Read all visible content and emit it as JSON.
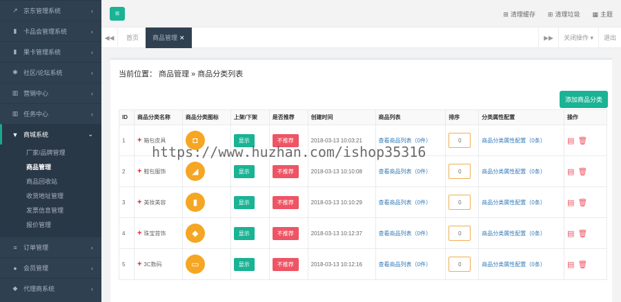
{
  "sidebar": {
    "items_top": [
      {
        "icon": "chart-icon",
        "glyph": "↗",
        "label": "京东管理系统"
      },
      {
        "icon": "bar-chart-icon",
        "glyph": "▮",
        "label": "卡品会管理系统"
      },
      {
        "icon": "bar-chart-icon",
        "glyph": "▮",
        "label": "果卡管理系统"
      },
      {
        "icon": "users-icon",
        "glyph": "✱",
        "label": "社区/论坛系统"
      },
      {
        "icon": "chart-icon",
        "glyph": "▥",
        "label": "营销中心"
      },
      {
        "icon": "chart-icon",
        "glyph": "▥",
        "label": "任务中心"
      }
    ],
    "active": {
      "icon": "cart-icon",
      "glyph": "▼",
      "label": "商城系统"
    },
    "sub_items": [
      "厂家/品牌管理",
      "商品管理",
      "商品回收站",
      "收货地址管理",
      "发票信息管理",
      "报价管理"
    ],
    "items_bottom": [
      {
        "icon": "list-icon",
        "glyph": "≡",
        "label": "订单管理"
      },
      {
        "icon": "user-icon",
        "glyph": "●",
        "label": "会员管理"
      },
      {
        "icon": "agent-icon",
        "glyph": "◆",
        "label": "代理商系统"
      }
    ]
  },
  "topbar": {
    "menu_glyph": "≡",
    "links": [
      "清理缓存",
      "清理垃圾",
      "主题"
    ]
  },
  "tabs": {
    "home": "首页",
    "active": "商品管理",
    "close_glyph": "✕",
    "right": [
      "▶▶",
      "关闭操作 ▾",
      "退出"
    ]
  },
  "breadcrumb": "当前位置： 商品管理 » 商品分类列表",
  "add_button": "添加商品分类",
  "watermark": "https://www.huzhan.com/ishop35316",
  "table": {
    "headers": [
      "ID",
      "商品分类名称",
      "商品分类图标",
      "上架/下架",
      "是否推荐",
      "创建时间",
      "商品列表",
      "排序",
      "分类属性配置",
      "操作"
    ],
    "rows": [
      {
        "id": "1",
        "name": "箱包皮具",
        "icon_glyph": "◘",
        "show": "显示",
        "rec": "不推荐",
        "time": "2018-03-13 10:03:21",
        "list": "查看商品列表（0件）",
        "sort": "0",
        "attr": "商品分类属性配置（0条）"
      },
      {
        "id": "2",
        "name": "鞋包服饰",
        "icon_glyph": "◢",
        "show": "显示",
        "rec": "不推荐",
        "time": "2018-03-13 10:10:08",
        "list": "查看商品列表（0件）",
        "sort": "0",
        "attr": "商品分类属性配置（0条）"
      },
      {
        "id": "3",
        "name": "美妆美容",
        "icon_glyph": "▮",
        "show": "显示",
        "rec": "不推荐",
        "time": "2018-03-13 10:10:29",
        "list": "查看商品列表（0件）",
        "sort": "0",
        "attr": "商品分类属性配置（0条）"
      },
      {
        "id": "4",
        "name": "珠宝首饰",
        "icon_glyph": "◆",
        "show": "显示",
        "rec": "不推荐",
        "time": "2018-03-13 10:12:37",
        "list": "查看商品列表（0件）",
        "sort": "0",
        "attr": "商品分类属性配置（0条）"
      },
      {
        "id": "5",
        "name": "3C数码",
        "icon_glyph": "▭",
        "show": "显示",
        "rec": "不推荐",
        "time": "2018-03-13 10:12:16",
        "list": "查看商品列表（0件）",
        "sort": "0",
        "attr": "商品分类属性配置（0条）"
      }
    ]
  },
  "colors": {
    "accent": "#1ab394",
    "danger": "#ed5565",
    "sidebar": "#2f4050",
    "icon_bg": "#f5a623",
    "link": "#337ab7"
  }
}
